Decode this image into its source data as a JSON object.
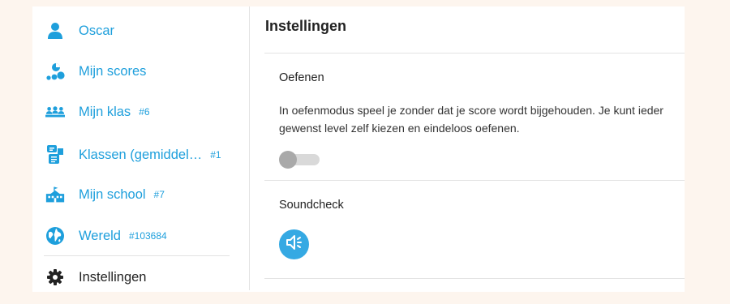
{
  "sidebar": {
    "items": [
      {
        "label": "Oscar",
        "rank": "",
        "icon": "user-icon"
      },
      {
        "label": "Mijn scores",
        "rank": "",
        "icon": "scores-icon"
      },
      {
        "label": "Mijn klas",
        "rank": "#6",
        "icon": "group-icon"
      },
      {
        "label": "Klassen (gemiddel…",
        "rank": "#1",
        "icon": "classes-icon"
      },
      {
        "label": "Mijn school",
        "rank": "#7",
        "icon": "school-icon"
      },
      {
        "label": "Wereld",
        "rank": "#103684",
        "icon": "globe-icon"
      },
      {
        "label": "Instellingen",
        "rank": "",
        "icon": "gear-icon"
      }
    ],
    "active_item": "Instellingen"
  },
  "main": {
    "title": "Instellingen",
    "practice": {
      "title": "Oefenen",
      "description": "In oefenmodus speel je zonder dat je score wordt bijgehouden. Je kunt ieder gewenst level zelf kiezen en eindeloos oefenen.",
      "toggle_on": false
    },
    "soundcheck": {
      "title": "Soundcheck",
      "icon": "speaker-icon"
    }
  },
  "colors": {
    "accent": "#1e9fdc",
    "background": "#fdf5ee",
    "toggle_off_knob": "#a9a9a9",
    "sound_button": "#35a9e3"
  }
}
